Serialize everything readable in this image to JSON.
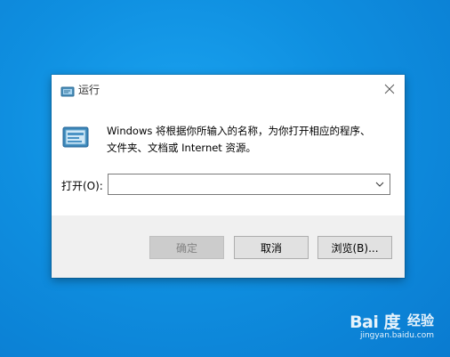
{
  "dialog": {
    "title": "运行",
    "description_line1": "Windows 将根据你所输入的名称，为你打开相应的程序、",
    "description_line2": "文件夹、文档或 Internet 资源。",
    "open_label": "打开(O):",
    "open_value": "",
    "buttons": {
      "ok": "确定",
      "cancel": "取消",
      "browse": "浏览(B)..."
    }
  },
  "watermark": {
    "logo": "Bai 度",
    "brand_cn": "经验",
    "url": "jingyan.baidu.com"
  },
  "icons": {
    "title": "run-icon",
    "main": "run-icon",
    "close": "close-icon",
    "dropdown": "chevron-down-icon"
  },
  "colors": {
    "desktop": "#0f8fe0",
    "dialog_bg": "#ffffff",
    "footer_bg": "#f0f0f0",
    "button_bg": "#e1e1e1"
  }
}
